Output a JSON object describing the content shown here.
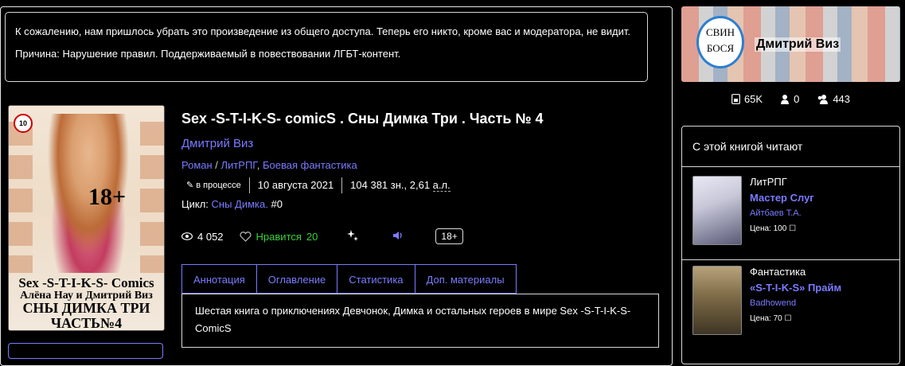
{
  "notice": {
    "line1": "К сожалению, нам пришлось убрать это произведение из общего доступа. Теперь его никто, кроме вас и модератора, не видит.",
    "line2": "Причина: Нарушение правил. Поддерживаемый в повествовании ЛГБТ-контент."
  },
  "cover": {
    "age_badge": "10",
    "plus18": "18+",
    "line1": "Sex -S-T-I-K-S- Comics",
    "line2": "Алёна Нау и Дмитрий Виз",
    "line3a": "СНЫ ДИМКА ТРИ",
    "line3b": "ЧАСТЬ№4"
  },
  "book": {
    "title": "Sex -S-T-I-K-S- comicS . Сны Димка Три . Часть № 4",
    "author": "Дмитрий Виз",
    "genre1": "Роман",
    "genre_sep": " / ",
    "genre2": "ЛитРПГ",
    "genre_comma": ", ",
    "genre3": "Боевая фантастика",
    "status": "в процессе",
    "date": "10 августа 2021",
    "size": "104 381 зн., 2,61 ",
    "size_unit": "а.л.",
    "cycle_label": "Цикл: ",
    "cycle_name": "Сны Димка.",
    "cycle_num": " #0",
    "views": "4 052",
    "likes_label": "Нравится",
    "likes_count": "20",
    "age": "18+"
  },
  "tabs": [
    "Аннотация",
    "Оглавление",
    "Статистика",
    "Доп. материалы"
  ],
  "annotation": "Шестая книга о приключениях Девчонок, Димка и остальных героев в мире Sex -S-T-I-K-S- ComicS",
  "profile": {
    "name": "Дмитрий Виз",
    "avatar_line1": "СВИН",
    "avatar_line2": "БОСЯ",
    "books": "65K",
    "following": "0",
    "followers": "443"
  },
  "sidebar": {
    "header": "С этой книгой читают",
    "recs": [
      {
        "genre": "ЛитРПГ",
        "title": "Мастер Слуг",
        "author": "Айтбаев Т.А.",
        "price": "Цена: 100"
      },
      {
        "genre": "Фантастика",
        "title": "«S-T-I-K-S» Прайм",
        "author": "Badhowend",
        "price": "Цена: 70"
      }
    ]
  },
  "colors": {
    "link": "#7b7bff",
    "like": "#3ad13a",
    "bg": "#000000"
  }
}
